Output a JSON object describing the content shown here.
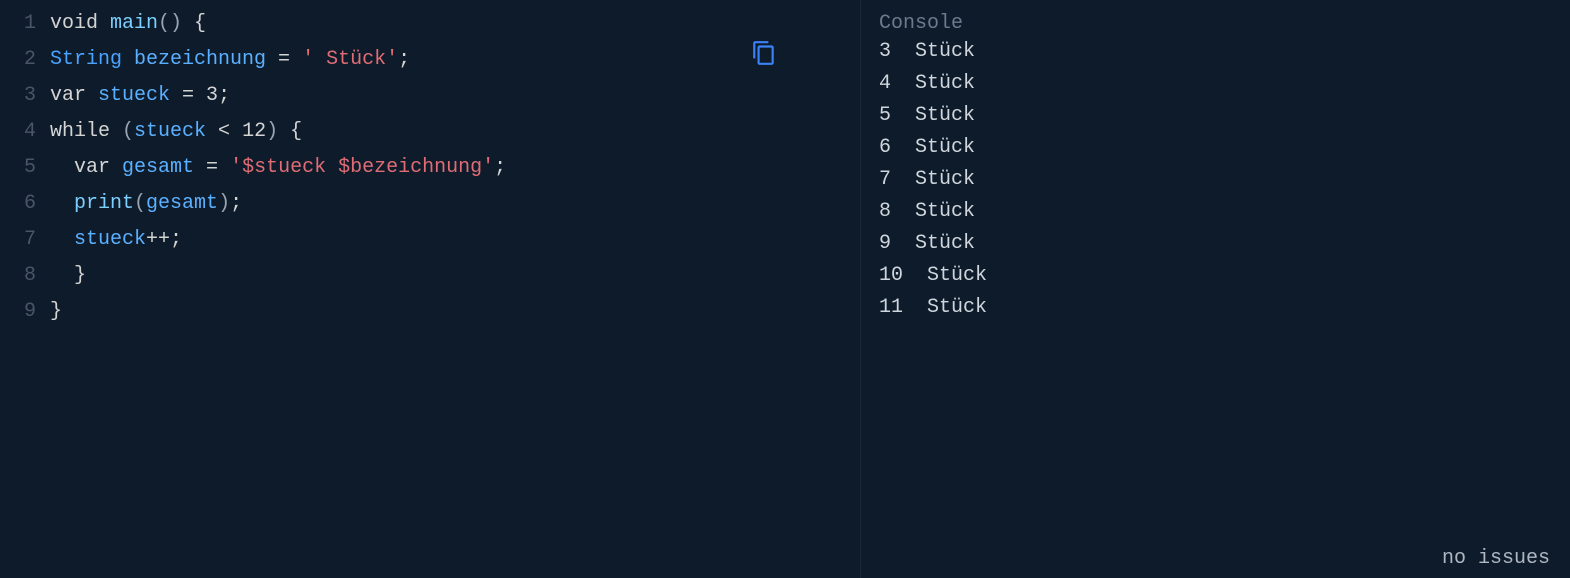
{
  "editor": {
    "lines": [
      {
        "num": "1",
        "tokens": [
          {
            "cls": "tok-keyword",
            "t": "void "
          },
          {
            "cls": "tok-func",
            "t": "main"
          },
          {
            "cls": "tok-paren",
            "t": "()"
          },
          {
            "cls": "tok-punct",
            "t": " {"
          }
        ]
      },
      {
        "num": "2",
        "tokens": [
          {
            "cls": "tok-type",
            "t": "String "
          },
          {
            "cls": "tok-ident",
            "t": "bezeichnung"
          },
          {
            "cls": "tok-punct",
            "t": " = "
          },
          {
            "cls": "tok-string",
            "t": "' Stück'"
          },
          {
            "cls": "tok-punct",
            "t": ";"
          }
        ]
      },
      {
        "num": "3",
        "tokens": [
          {
            "cls": "tok-keyword",
            "t": "var "
          },
          {
            "cls": "tok-ident",
            "t": "stueck"
          },
          {
            "cls": "tok-punct",
            "t": " = "
          },
          {
            "cls": "tok-num",
            "t": "3"
          },
          {
            "cls": "tok-punct",
            "t": ";"
          }
        ]
      },
      {
        "num": "4",
        "tokens": [
          {
            "cls": "tok-keyword",
            "t": "while "
          },
          {
            "cls": "tok-paren",
            "t": "("
          },
          {
            "cls": "tok-ident",
            "t": "stueck"
          },
          {
            "cls": "tok-punct",
            "t": " < "
          },
          {
            "cls": "tok-num",
            "t": "12"
          },
          {
            "cls": "tok-paren",
            "t": ")"
          },
          {
            "cls": "tok-punct",
            "t": " {"
          }
        ]
      },
      {
        "num": "5",
        "tokens": [
          {
            "cls": "tok-punct",
            "t": "  "
          },
          {
            "cls": "tok-keyword",
            "t": "var "
          },
          {
            "cls": "tok-ident",
            "t": "gesamt"
          },
          {
            "cls": "tok-punct",
            "t": " = "
          },
          {
            "cls": "tok-string",
            "t": "'$stueck $bezeichnung'"
          },
          {
            "cls": "tok-punct",
            "t": ";"
          }
        ]
      },
      {
        "num": "6",
        "tokens": [
          {
            "cls": "tok-punct",
            "t": "  "
          },
          {
            "cls": "tok-func",
            "t": "print"
          },
          {
            "cls": "tok-paren",
            "t": "("
          },
          {
            "cls": "tok-ident",
            "t": "gesamt"
          },
          {
            "cls": "tok-paren",
            "t": ")"
          },
          {
            "cls": "tok-punct",
            "t": ";"
          }
        ]
      },
      {
        "num": "7",
        "tokens": [
          {
            "cls": "tok-punct",
            "t": "  "
          },
          {
            "cls": "tok-ident",
            "t": "stueck"
          },
          {
            "cls": "tok-punct",
            "t": "++;"
          }
        ]
      },
      {
        "num": "8",
        "tokens": [
          {
            "cls": "tok-punct",
            "t": "  }"
          }
        ]
      },
      {
        "num": "9",
        "tokens": [
          {
            "cls": "tok-punct",
            "t": "}"
          }
        ]
      }
    ]
  },
  "console": {
    "title": "Console",
    "output": [
      "3  Stück",
      "4  Stück",
      "5  Stück",
      "6  Stück",
      "7  Stück",
      "8  Stück",
      "9  Stück",
      "10  Stück",
      "11  Stück"
    ],
    "status": "no issues"
  }
}
